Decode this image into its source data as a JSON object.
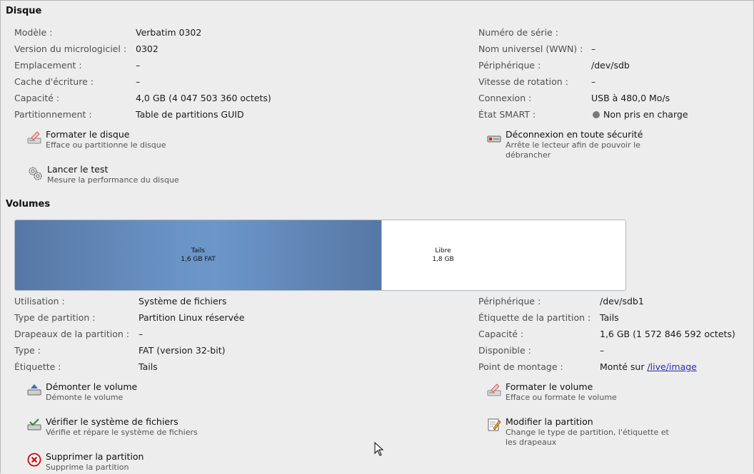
{
  "disk": {
    "title": "Disque",
    "left_rows": [
      {
        "label": "Modèle :",
        "value": "Verbatim 0302"
      },
      {
        "label": "Version du micrologiciel :",
        "value": "0302"
      },
      {
        "label": "Emplacement :",
        "value": "–"
      },
      {
        "label": "Cache d'écriture :",
        "value": "–"
      },
      {
        "label": "Capacité :",
        "value": "4,0 GB (4 047 503 360 octets)"
      },
      {
        "label": "Partitionnement :",
        "value": "Table de partitions GUID"
      }
    ],
    "right_rows": [
      {
        "label": "Numéro de série :",
        "value": ""
      },
      {
        "label": "Nom universel (WWN) :",
        "value": "–"
      },
      {
        "label": "Périphérique :",
        "value": "/dev/sdb"
      },
      {
        "label": "Vitesse de rotation :",
        "value": "–"
      },
      {
        "label": "Connexion :",
        "value": "USB à 480,0 Mo/s"
      },
      {
        "label": "État SMART :",
        "value": "Non pris en charge"
      }
    ],
    "actions": {
      "format": {
        "title": "Formater le disque",
        "desc": "Efface ou partitionne le disque",
        "icon": "format-disk-icon"
      },
      "benchmark": {
        "title": "Lancer le test",
        "desc": "Mesure la performance du disque",
        "icon": "gears-icon"
      },
      "safe_remove": {
        "title": "Déconnexion en toute sécurité",
        "desc": "Arrête le lecteur afin de pouvoir le débrancher",
        "icon": "eject-drive-icon"
      }
    }
  },
  "volumes": {
    "title": "Volumes",
    "bar": {
      "tails": {
        "name": "Tails",
        "size": "1,6 GB FAT",
        "fraction": 0.4
      },
      "free": {
        "name": "Libre",
        "size": "1,8 GB"
      }
    },
    "left_rows": [
      {
        "label": "Utilisation :",
        "value": "Système de fichiers"
      },
      {
        "label": "Type de partition :",
        "value": "Partition Linux réservée"
      },
      {
        "label": "Drapeaux de la partition :",
        "value": "–"
      },
      {
        "label": "Type :",
        "value": "FAT (version 32-bit)"
      },
      {
        "label": "Étiquette :",
        "value": "Tails"
      }
    ],
    "right_rows": [
      {
        "label": "Périphérique :",
        "value": "/dev/sdb1"
      },
      {
        "label": "Étiquette de la partition :",
        "value": "Tails"
      },
      {
        "label": "Capacité :",
        "value": "1,6 GB (1 572 846 592 octets)"
      },
      {
        "label": "Disponible :",
        "value": "–"
      },
      {
        "label": "Point de montage :",
        "value_prefix": "Monté sur ",
        "value_link": "/live/image"
      }
    ],
    "actions": {
      "unmount": {
        "title": "Démonter le volume",
        "desc": "Démonte le volume",
        "icon": "unmount-icon"
      },
      "check": {
        "title": "Vérifier le système de fichiers",
        "desc": "Vérifie et répare le système de fichiers",
        "icon": "check-fs-icon"
      },
      "delete": {
        "title": "Supprimer la partition",
        "desc": "Supprime la partition",
        "icon": "delete-icon"
      },
      "format": {
        "title": "Formater le volume",
        "desc": "Efface ou formate le volume",
        "icon": "format-volume-icon"
      },
      "edit": {
        "title": "Modifier la partition",
        "desc": "Change le type de partition, l'étiquette et les drapeaux",
        "icon": "edit-partition-icon"
      }
    }
  },
  "colors": {
    "volume_used": "#6a94c6",
    "link": "#2a2ab0",
    "smart_dot": "#7a7a7a"
  }
}
